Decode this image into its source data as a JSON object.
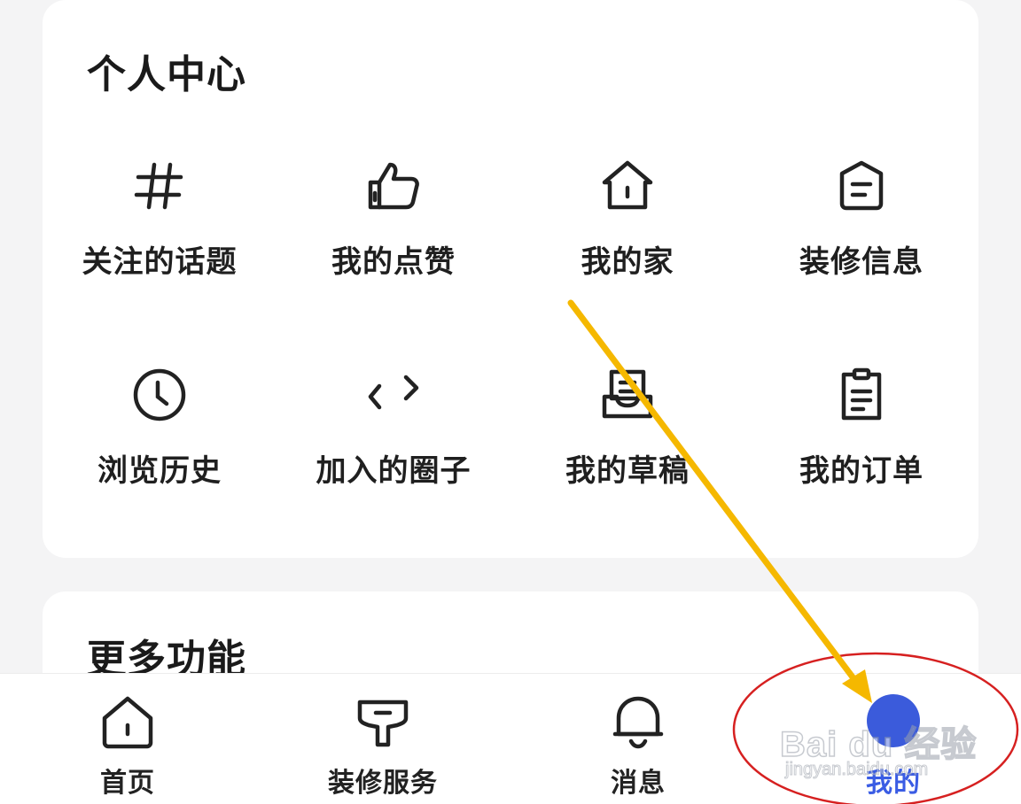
{
  "personal_center": {
    "title": "个人中心",
    "items": [
      {
        "label": "关注的话题",
        "icon": "hashtag-icon"
      },
      {
        "label": "我的点赞",
        "icon": "thumbs-up-icon"
      },
      {
        "label": "我的家",
        "icon": "home-icon"
      },
      {
        "label": "装修信息",
        "icon": "document-icon"
      },
      {
        "label": "浏览历史",
        "icon": "clock-icon"
      },
      {
        "label": "加入的圈子",
        "icon": "code-brackets-icon"
      },
      {
        "label": "我的草稿",
        "icon": "draft-tray-icon"
      },
      {
        "label": "我的订单",
        "icon": "clipboard-icon"
      }
    ]
  },
  "more_features": {
    "title": "更多功能"
  },
  "tabbar": {
    "tabs": [
      {
        "label": "首页",
        "icon": "home-icon",
        "active": false
      },
      {
        "label": "装修服务",
        "icon": "roller-icon",
        "active": false
      },
      {
        "label": "消息",
        "icon": "bell-icon",
        "active": false
      },
      {
        "label": "我的",
        "icon": "profile-icon",
        "active": true
      }
    ]
  },
  "watermark": {
    "main": "Bai du 经验",
    "sub": "jingyan.baidu.com"
  },
  "colors": {
    "accent": "#3b5bdb",
    "annotation_arrow": "#f5b800",
    "annotation_circle": "#d62020"
  }
}
